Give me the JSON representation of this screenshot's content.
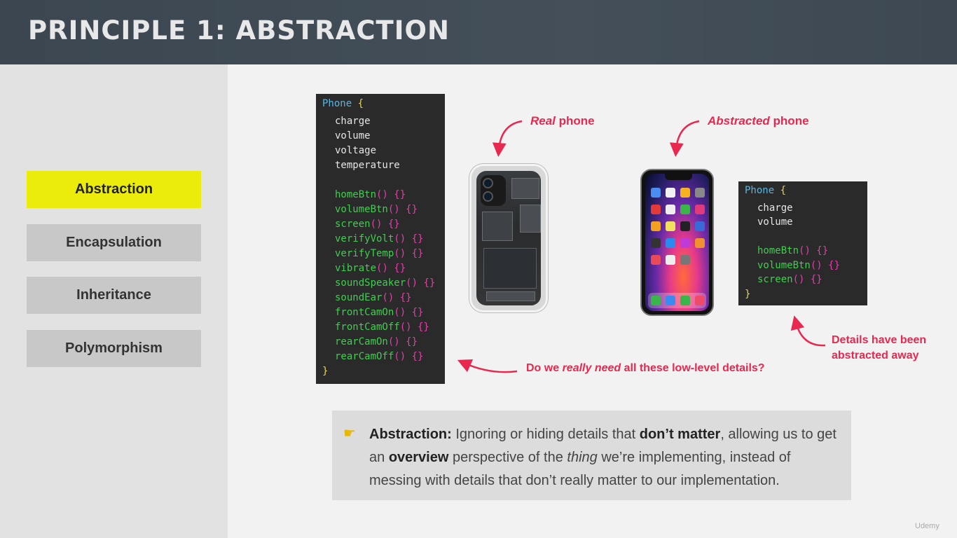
{
  "header": {
    "title": "PRINCIPLE 1: ABSTRACTION"
  },
  "sidebar": {
    "items": [
      {
        "label": "Abstraction",
        "active": true
      },
      {
        "label": "Encapsulation",
        "active": false
      },
      {
        "label": "Inheritance",
        "active": false
      },
      {
        "label": "Polymorphism",
        "active": false
      }
    ]
  },
  "code_full": {
    "class_name": "Phone",
    "open": "{",
    "close": "}",
    "props": [
      "charge",
      "volume",
      "voltage",
      "temperature"
    ],
    "methods": [
      "homeBtn",
      "volumeBtn",
      "screen",
      "verifyVolt",
      "verifyTemp",
      "vibrate",
      "soundSpeaker",
      "soundEar",
      "frontCamOn",
      "frontCamOff",
      "rearCamOn",
      "rearCamOff"
    ],
    "method_suffix": "() {}"
  },
  "code_abstract": {
    "class_name": "Phone",
    "open": "{",
    "close": "}",
    "props": [
      "charge",
      "volume"
    ],
    "methods": [
      "homeBtn",
      "volumeBtn",
      "screen"
    ],
    "method_suffix": "() {}"
  },
  "annotations": {
    "real_em": "Real",
    "real_rest": " phone",
    "abstracted_em": "Abstracted",
    "abstracted_rest": " phone",
    "question_pre": "Do we ",
    "question_em": "really need",
    "question_post": " all these low-level details?",
    "details_line1": "Details have been",
    "details_line2": "abstracted away"
  },
  "callout": {
    "term": "Abstraction:",
    "t1": " Ignoring or hiding details that ",
    "b1": "don’t matter",
    "t2": ", allowing us to get an ",
    "b2": "overview",
    "t3": " perspective of the ",
    "i1": "thing",
    "t4": " we’re implementing, instead of messing with details that don’t really matter to our implementation."
  },
  "watermark": "Udemy",
  "colors": {
    "accent": "#ecec0a",
    "annotation": "#e8284e",
    "keyword": "#5ab6e0",
    "method": "#3ecf4f",
    "parens": "#e040a8",
    "brace": "#e8d44d"
  }
}
